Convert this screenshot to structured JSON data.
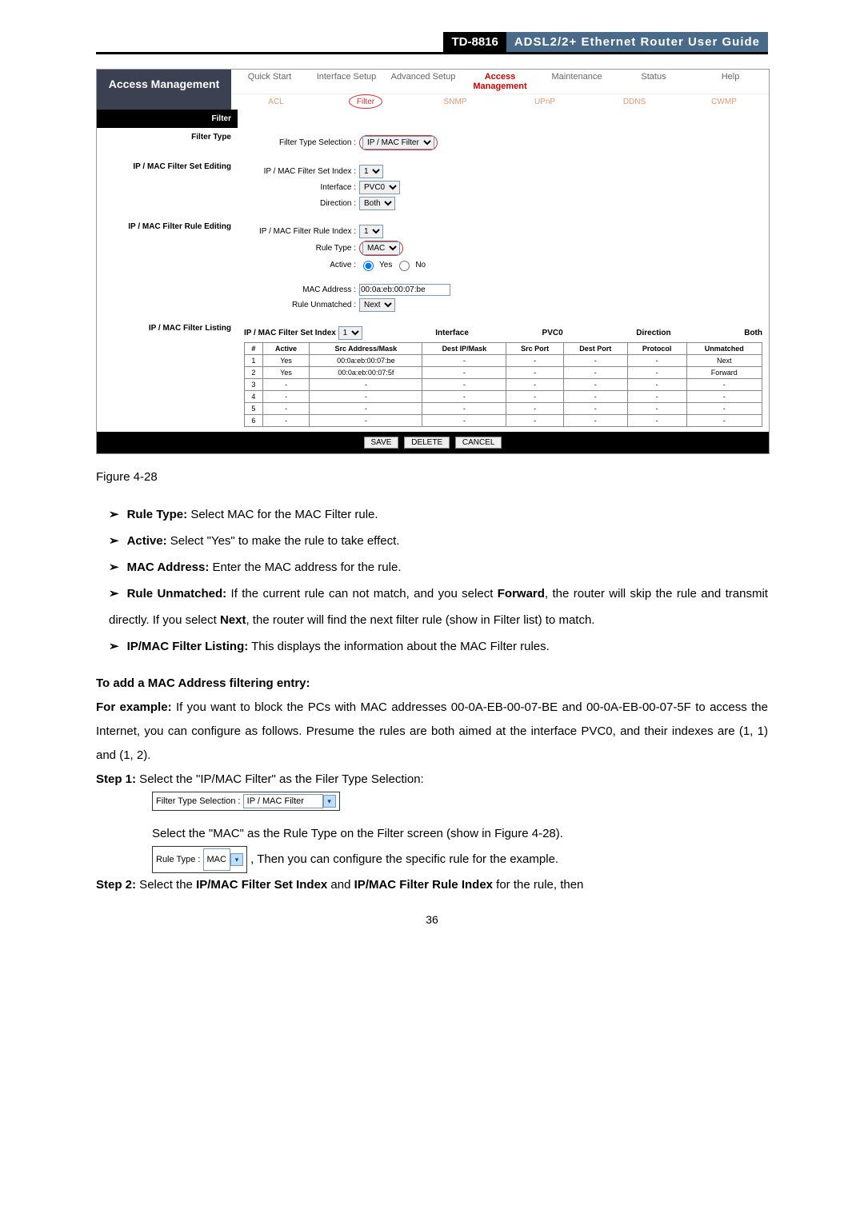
{
  "header": {
    "model": "TD-8816",
    "title": "ADSL2/2+  Ethernet  Router  User  Guide"
  },
  "ui": {
    "left_title": "Access Management",
    "tabs": [
      "Quick Start",
      "Interface Setup",
      "Advanced Setup",
      "Access Management",
      "Maintenance",
      "Status",
      "Help"
    ],
    "subtabs": [
      "ACL",
      "Filter",
      "SNMP",
      "UPnP",
      "DDNS",
      "CWMP"
    ],
    "section_filter": "Filter",
    "section_filter_type": "Filter Type",
    "ft_label": "Filter Type Selection :",
    "ft_value": "IP / MAC Filter",
    "section_set": "IP / MAC Filter Set Editing",
    "set_index_label": "IP / MAC Filter Set Index :",
    "set_index": "1",
    "interface_label": "Interface :",
    "interface": "PVC0",
    "direction_label": "Direction :",
    "direction": "Both",
    "section_rule": "IP / MAC Filter Rule Editing",
    "rule_index_label": "IP / MAC Filter Rule Index :",
    "rule_index": "1",
    "rule_type_label": "Rule Type :",
    "rule_type": "MAC",
    "active_label": "Active :",
    "active_yes": "Yes",
    "active_no": "No",
    "mac_label": "MAC Address :",
    "mac": "00:0a:eb:00:07:be",
    "unmatched_label": "Rule Unmatched :",
    "unmatched": "Next",
    "section_listing": "IP / MAC Filter Listing",
    "listing_label": "IP / MAC Filter Set Index",
    "listing_index": "1",
    "listing_if_label": "Interface",
    "listing_if": "PVC0",
    "listing_dir_label": "Direction",
    "listing_dir": "Both",
    "cols": [
      "#",
      "Active",
      "Src Address/Mask",
      "Dest IP/Mask",
      "Src Port",
      "Dest Port",
      "Protocol",
      "Unmatched"
    ],
    "rows": [
      {
        "n": "1",
        "active": "Yes",
        "src": "00:0a:eb:00:07:be",
        "dest": "-",
        "sp": "-",
        "dp": "-",
        "proto": "-",
        "un": "Next"
      },
      {
        "n": "2",
        "active": "Yes",
        "src": "00:0a:eb:00:07:5f",
        "dest": "-",
        "sp": "-",
        "dp": "-",
        "proto": "-",
        "un": "Forward"
      },
      {
        "n": "3",
        "active": "-",
        "src": "-",
        "dest": "-",
        "sp": "-",
        "dp": "-",
        "proto": "-",
        "un": "-"
      },
      {
        "n": "4",
        "active": "-",
        "src": "-",
        "dest": "-",
        "sp": "-",
        "dp": "-",
        "proto": "-",
        "un": "-"
      },
      {
        "n": "5",
        "active": "-",
        "src": "-",
        "dest": "-",
        "sp": "-",
        "dp": "-",
        "proto": "-",
        "un": "-"
      },
      {
        "n": "6",
        "active": "-",
        "src": "-",
        "dest": "-",
        "sp": "-",
        "dp": "-",
        "proto": "-",
        "un": "-"
      }
    ],
    "btn_save": "SAVE",
    "btn_delete": "DELETE",
    "btn_cancel": "CANCEL"
  },
  "figure": "Figure 4-28",
  "bullets": {
    "b1_l": "Rule Type:",
    "b1_t": " Select MAC for the MAC Filter rule.",
    "b2_l": "Active:",
    "b2_t": " Select \"Yes\" to make the rule to take effect.",
    "b3_l": "MAC Address:",
    "b3_t": " Enter the MAC address for the rule.",
    "b4_l": "Rule Unmatched:",
    "b4_t": " If the current rule can not match, and you select ",
    "b4_f": "Forward",
    "b4_t2": ", the router will skip the rule and transmit directly. If you select ",
    "b4_n": "Next",
    "b4_t3": ", the router will find the next filter rule (show in Filter list) to match.",
    "b5_l": "IP/MAC Filter Listing:",
    "b5_t": " This displays the information about the MAC Filter rules."
  },
  "proc": {
    "heading": "To add a MAC Address filtering entry:",
    "example_l": "For example:",
    "example_t": " If you want to block the PCs with MAC addresses 00-0A-EB-00-07-BE and 00-0A-EB-00-07-5F to access the Internet, you can configure as follows. Presume the rules are both aimed at the interface PVC0, and their indexes are (1, 1) and (1, 2).",
    "s1_l": "Step 1:",
    "s1_t": "  Select the \"IP/MAC Filter\" as the Filer Type Selection:",
    "inline1_l": "Filter Type Selection :",
    "inline1_v": "IP / MAC Filter",
    "s1b": "Select  the  \"MAC\"  as  the  Rule  Type  on  the  Filter  screen  (show  in  Figure  4-28).",
    "inline2_l": "Rule Type :",
    "inline2_v": "MAC",
    "s1c": ", Then you can configure the specific rule for the example.",
    "s2_l": "Step 2:",
    "s2_t": "  Select the ",
    "s2_b1": "IP/MAC Filter Set Index",
    "s2_m": " and ",
    "s2_b2": "IP/MAC Filter Rule Index",
    "s2_e": " for the rule, then"
  },
  "page_num": "36"
}
